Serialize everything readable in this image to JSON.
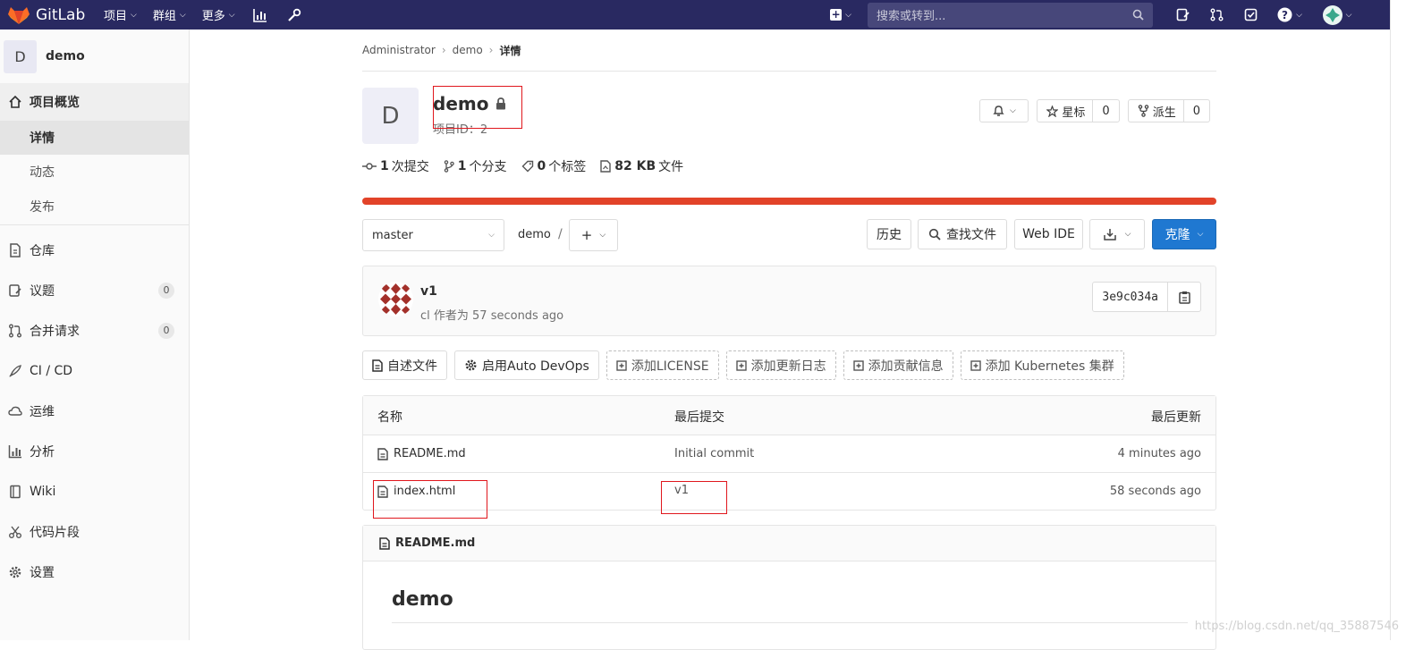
{
  "topbar": {
    "brand": "GitLab",
    "nav": [
      "项目",
      "群组",
      "更多"
    ],
    "search_placeholder": "搜索或转到..."
  },
  "sidebar": {
    "project_initial": "D",
    "project_name": "demo",
    "overview": "项目概览",
    "overview_sub": [
      "详情",
      "动态",
      "发布"
    ],
    "items": [
      {
        "label": "仓库",
        "icon": "doc-icon"
      },
      {
        "label": "议题",
        "icon": "issues-icon",
        "badge": "0"
      },
      {
        "label": "合并请求",
        "icon": "merge-request-icon",
        "badge": "0"
      },
      {
        "label": "CI / CD",
        "icon": "rocket-icon"
      },
      {
        "label": "运维",
        "icon": "cloud-icon"
      },
      {
        "label": "分析",
        "icon": "chart-icon"
      },
      {
        "label": "Wiki",
        "icon": "book-icon"
      },
      {
        "label": "代码片段",
        "icon": "scissors-icon"
      },
      {
        "label": "设置",
        "icon": "gear-icon"
      }
    ]
  },
  "breadcrumb": [
    "Administrator",
    "demo",
    "详情"
  ],
  "project": {
    "initial": "D",
    "title": "demo",
    "id_text": "项目ID：2",
    "star_label": "星标",
    "star_count": "0",
    "fork_label": "派生",
    "fork_count": "0"
  },
  "stats": [
    {
      "value": "1",
      "label": "次提交"
    },
    {
      "value": "1",
      "label": "个分支"
    },
    {
      "value": "0",
      "label": "个标签"
    },
    {
      "value": "82 KB",
      "label": "文件"
    }
  ],
  "toolbar": {
    "branch": "master",
    "path": "demo",
    "path_sep": "/",
    "history": "历史",
    "find_file": "查找文件",
    "web_ide": "Web IDE",
    "clone": "克隆"
  },
  "commit": {
    "title": "v1",
    "meta": "cl 作者为 57 seconds ago",
    "sha": "3e9c034a"
  },
  "quick_actions": [
    {
      "label": "自述文件",
      "style": "solid",
      "icon": "file-icon"
    },
    {
      "label": "启用Auto DevOps",
      "style": "solid",
      "icon": "gear-icon"
    },
    {
      "label": "添加LICENSE",
      "style": "dashed",
      "icon": "plus-square-icon"
    },
    {
      "label": "添加更新日志",
      "style": "dashed",
      "icon": "plus-square-icon"
    },
    {
      "label": "添加贡献信息",
      "style": "dashed",
      "icon": "plus-square-icon"
    },
    {
      "label": "添加 Kubernetes 集群",
      "style": "dashed",
      "icon": "plus-square-icon"
    }
  ],
  "files": {
    "headers": [
      "名称",
      "最后提交",
      "最后更新"
    ],
    "rows": [
      {
        "name": "README.md",
        "commit": "Initial commit",
        "updated": "4 minutes ago"
      },
      {
        "name": "index.html",
        "commit": "v1",
        "updated": "58 seconds ago"
      }
    ]
  },
  "readme": {
    "filename": "README.md",
    "heading": "demo"
  },
  "watermark": "https://blog.csdn.net/qq_35887546",
  "colors": {
    "topbar": "#292961",
    "progress": "#e24329",
    "clone_button": "#1f78d1",
    "annotation_box": "#e0171d"
  }
}
